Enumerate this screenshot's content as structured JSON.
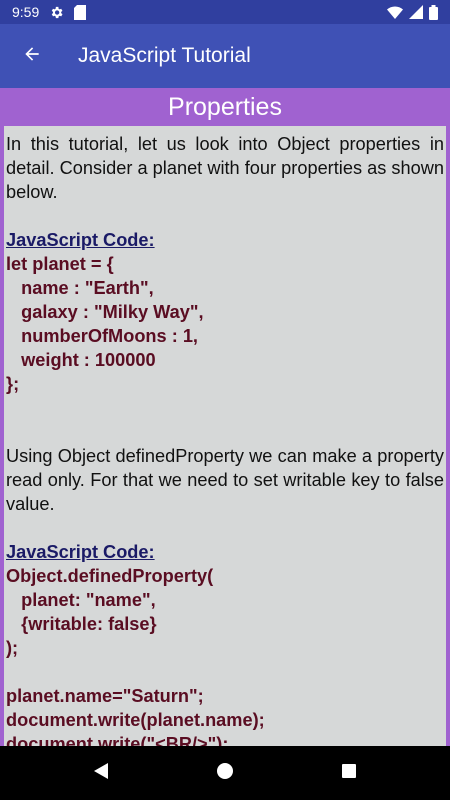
{
  "status_bar": {
    "time": "9:59",
    "icons_left": [
      "gear-icon",
      "sd-card-icon"
    ],
    "icons_right": [
      "wifi-icon",
      "signal-icon",
      "battery-icon"
    ]
  },
  "app_bar": {
    "title": "JavaScript Tutorial",
    "back_icon": "arrow-back-icon",
    "background": "#3f51b5"
  },
  "page": {
    "header": "Properties",
    "accent": "#a062d0",
    "content_background": "#d6d8d8"
  },
  "content": {
    "intro": "In this tutorial, let us look into Object properties in detail. Consider a planet with four properties as shown below.",
    "code_heading_1": "JavaScript Code:",
    "code_1": [
      "let planet = {",
      "   name : \"Earth\",",
      "   galaxy : \"Milky Way\",",
      "   numberOfMoons : 1,",
      "   weight : 100000",
      "};"
    ],
    "para_2": "Using Object definedProperty we can make a property read only. For that we need to set writable key to false value.",
    "code_heading_2": "JavaScript Code:",
    "code_2": [
      "Object.definedProperty(",
      "   planet: \"name\",",
      "   {writable: false}",
      ");"
    ],
    "code_3": [
      "planet.name=\"Saturn\";",
      "document.write(planet.name);",
      "document.write(\"<BR/>\");"
    ]
  },
  "nav_bar": {
    "buttons": [
      "back-triangle-icon",
      "home-circle-icon",
      "recents-square-icon"
    ]
  }
}
